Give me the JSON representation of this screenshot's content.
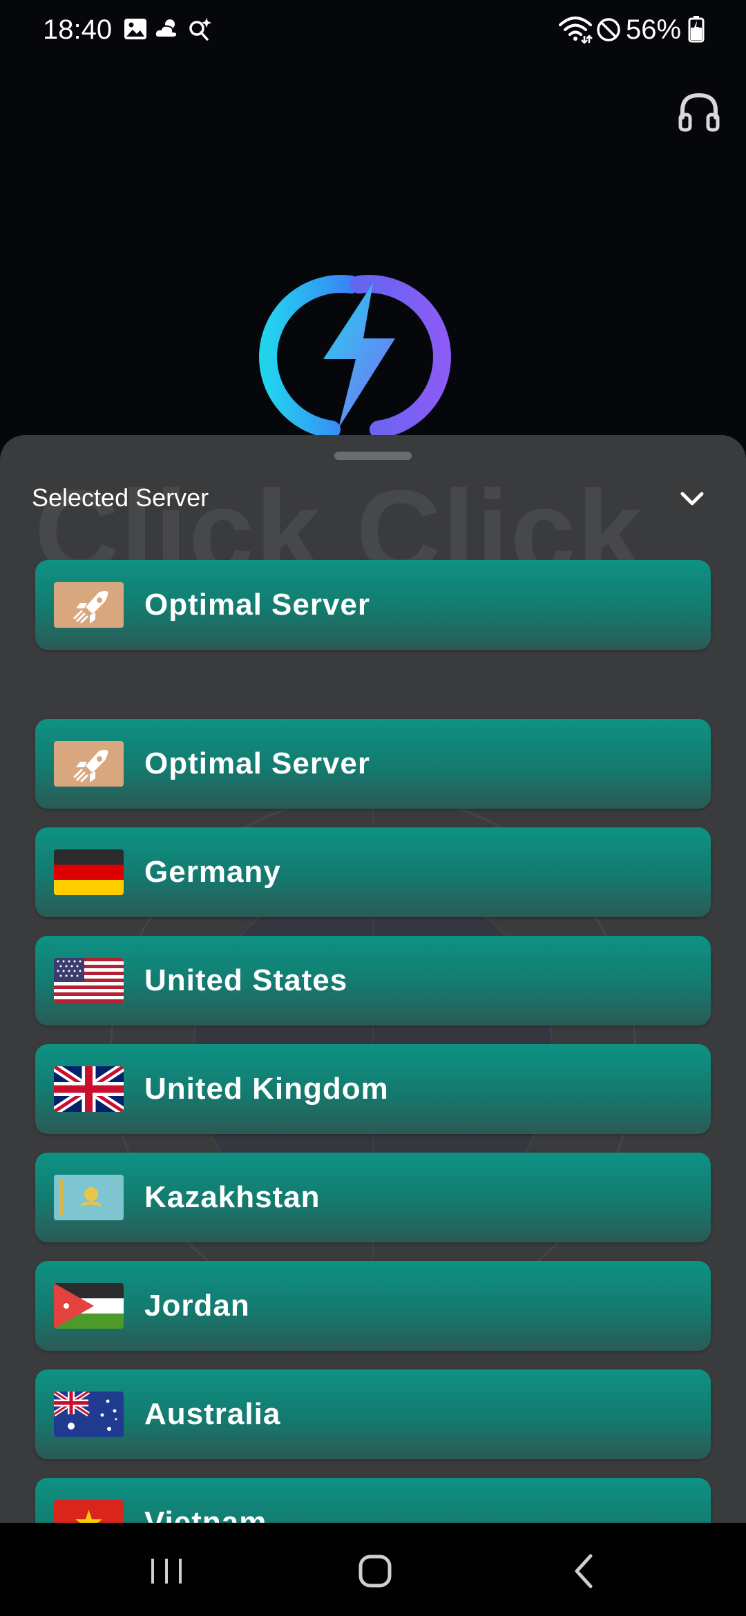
{
  "status_bar": {
    "time": "18:40",
    "battery": "56%",
    "icons": [
      "image-icon",
      "weather-icon",
      "search-sparkle-icon",
      "wifi-icon",
      "do-not-disturb-icon",
      "battery-icon"
    ]
  },
  "header": {
    "support_icon": "headset-icon"
  },
  "logo": {
    "icon": "lightning-logo-icon",
    "colors": [
      "#22d3ee",
      "#8b5cf6"
    ]
  },
  "sheet": {
    "title": "Selected Server",
    "watermark": "Click Click",
    "collapse_icon": "chevron-down-icon",
    "selected": {
      "name": "Optimal Server",
      "icon": "rocket-icon"
    },
    "servers": [
      {
        "name": "Optimal Server",
        "icon": "rocket-icon"
      },
      {
        "name": "Germany",
        "icon": "flag-germany-icon"
      },
      {
        "name": "United States",
        "icon": "flag-us-icon"
      },
      {
        "name": "United Kingdom",
        "icon": "flag-uk-icon"
      },
      {
        "name": "Kazakhstan",
        "icon": "flag-kazakhstan-icon"
      },
      {
        "name": "Jordan",
        "icon": "flag-jordan-icon"
      },
      {
        "name": "Australia",
        "icon": "flag-australia-icon"
      },
      {
        "name": "Vietnam",
        "icon": "flag-vietnam-icon"
      }
    ]
  },
  "nav_bar": {
    "icons": [
      "recents-icon",
      "home-icon",
      "back-icon"
    ]
  },
  "colors": {
    "card_top": "#0d9283",
    "card_bottom": "#2b5a55",
    "sheet_bg": "#3a3b3d",
    "app_bg": "#05070b"
  }
}
